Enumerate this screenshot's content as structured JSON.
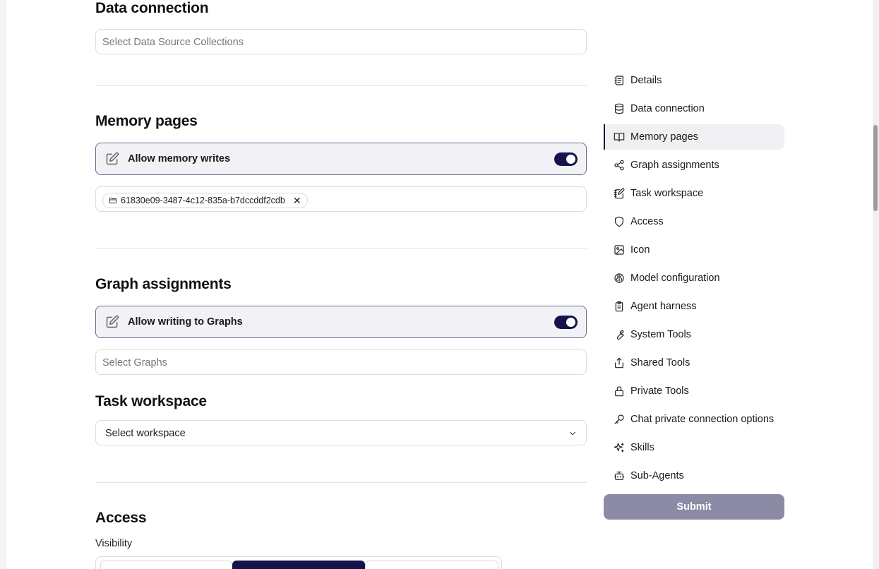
{
  "sections": {
    "data_connection": {
      "title": "Data connection",
      "placeholder": "Select Data Source Collections"
    },
    "memory_pages": {
      "title": "Memory pages",
      "toggle_label": "Allow memory writes",
      "toggle_on": true,
      "selected_chip": "61830e09-3487-4c12-835a-b7dccddf2cdb"
    },
    "graph_assignments": {
      "title": "Graph assignments",
      "toggle_label": "Allow writing to Graphs",
      "toggle_on": true,
      "placeholder": "Select Graphs"
    },
    "task_workspace": {
      "title": "Task workspace",
      "select_value": "Select workspace"
    },
    "access": {
      "title": "Access",
      "visibility_label": "Visibility"
    }
  },
  "nav": {
    "items": [
      {
        "label": "Details",
        "icon": "details-icon"
      },
      {
        "label": "Data connection",
        "icon": "database-icon"
      },
      {
        "label": "Memory pages",
        "icon": "book-icon",
        "active": true
      },
      {
        "label": "Graph assignments",
        "icon": "share-icon"
      },
      {
        "label": "Task workspace",
        "icon": "notebook-pen-icon"
      },
      {
        "label": "Access",
        "icon": "shield-icon"
      },
      {
        "label": "Icon",
        "icon": "image-icon"
      },
      {
        "label": "Model configuration",
        "icon": "brain-icon"
      },
      {
        "label": "Agent harness",
        "icon": "clipboard-icon"
      },
      {
        "label": "System Tools",
        "icon": "wrench-icon"
      },
      {
        "label": "Shared Tools",
        "icon": "share-upload-icon"
      },
      {
        "label": "Private Tools",
        "icon": "lock-icon"
      },
      {
        "label": "Chat private connection options",
        "icon": "key-icon"
      },
      {
        "label": "Skills",
        "icon": "sparkles-icon"
      },
      {
        "label": "Sub-Agents",
        "icon": "bot-icon"
      }
    ],
    "submit_label": "Submit"
  },
  "colors": {
    "accent": "#14144a",
    "submit_disabled": "#8b8ba6",
    "active_nav_bg": "#f0f0f2"
  }
}
